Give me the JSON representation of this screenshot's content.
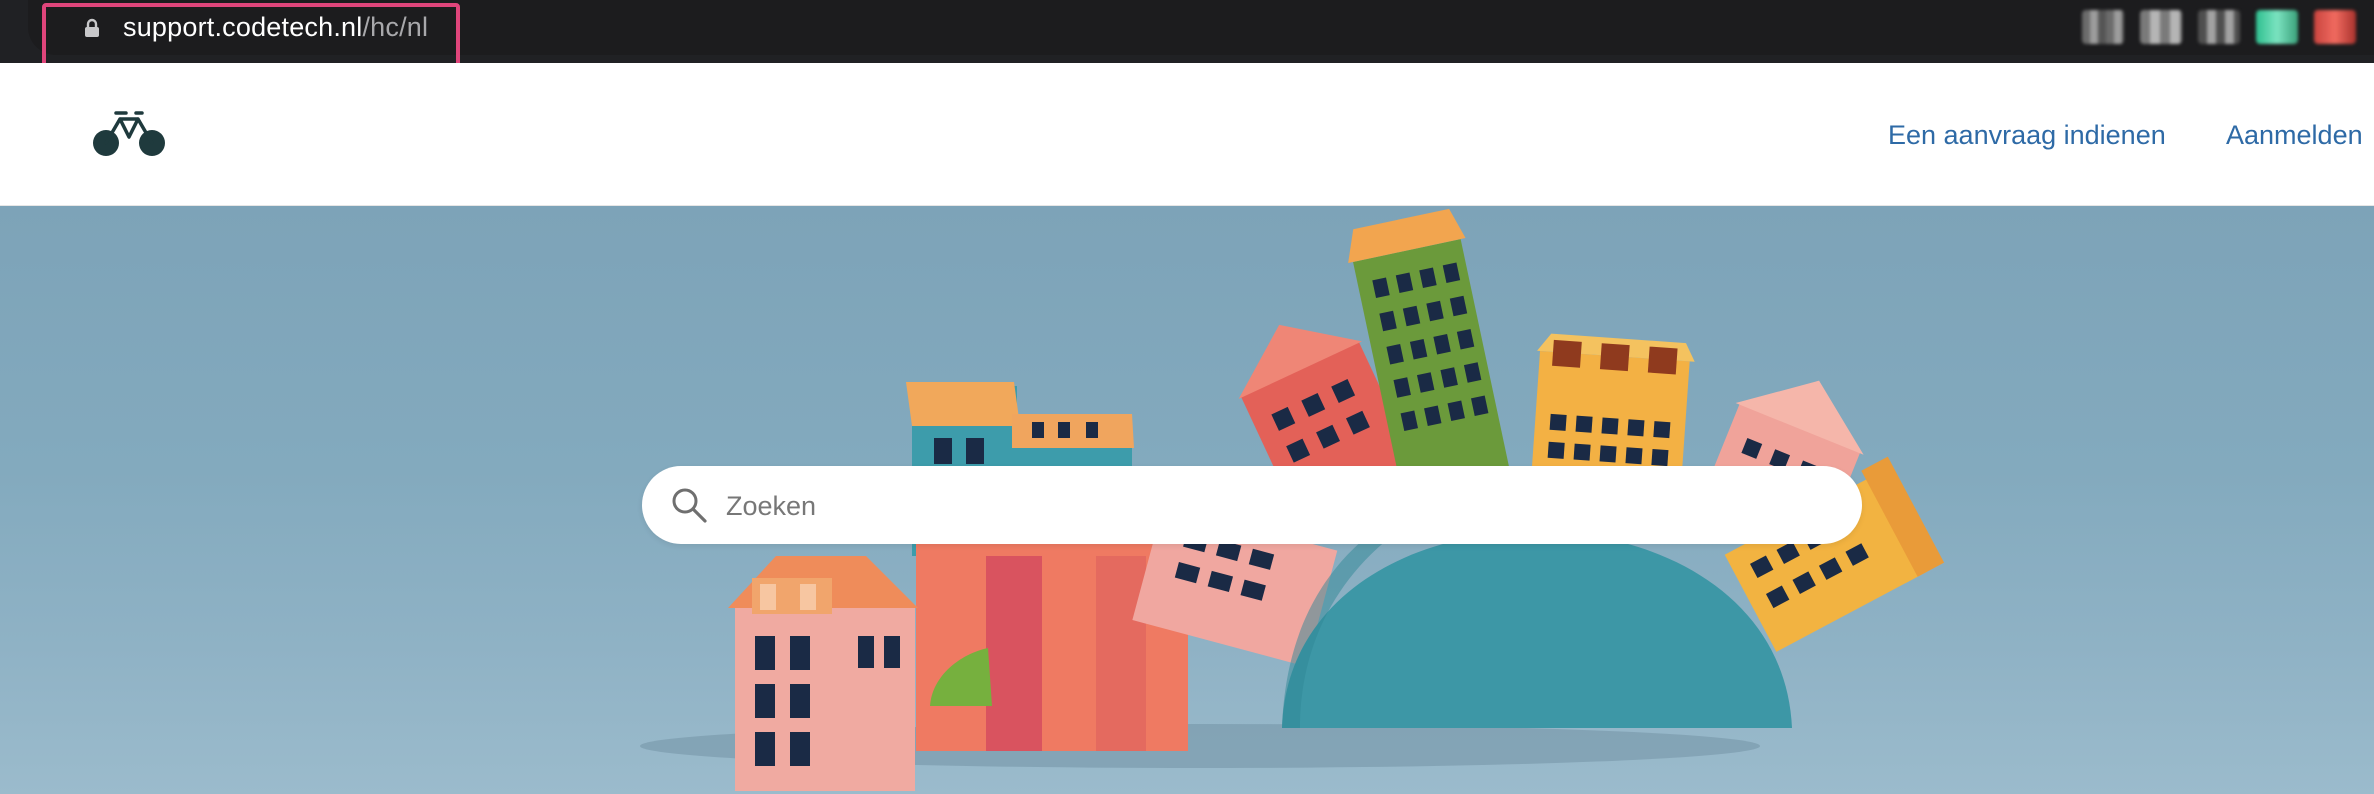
{
  "browser": {
    "url_domain": "support.codetech.nl",
    "url_path": "/hc/nl",
    "icons": [
      "lock-icon",
      "extension-icon",
      "extension-icon",
      "extension-icon",
      "extension-icon",
      "extension-icon"
    ]
  },
  "header": {
    "logo_icon": "bicycle-logo-icon",
    "nav": {
      "submit_request_label": "Een aanvraag indienen",
      "sign_in_label": "Aanmelden"
    },
    "link_color": "#2e6aa6"
  },
  "hero": {
    "image": "paper-craft-houses-illustration",
    "search": {
      "placeholder": "Zoeken",
      "icon": "search-icon"
    }
  },
  "colors": {
    "highlight": "#e0457b",
    "chrome_bg": "#202124",
    "hero_bg": "#83aabe"
  }
}
